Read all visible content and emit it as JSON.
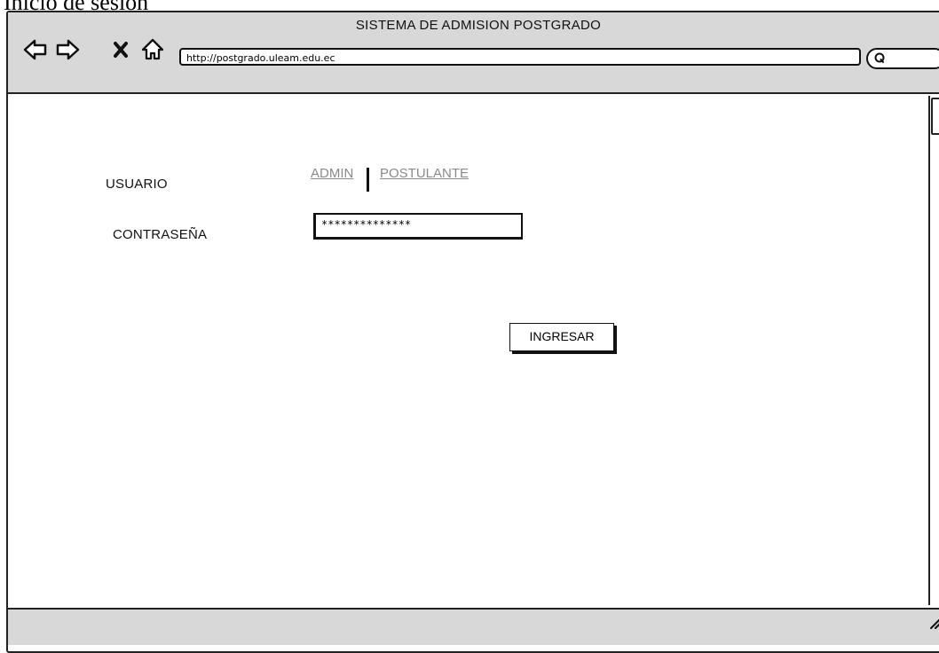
{
  "caption": "Inicio de sesión",
  "window": {
    "title": "SISTEMA DE ADMISION POSTGRADO"
  },
  "browser": {
    "url": "http://postgrado.uleam.edu.ec",
    "icons": [
      "back-arrow-icon",
      "forward-arrow-icon",
      "close-icon",
      "home-icon",
      "search-icon",
      "resize-grip-icon"
    ]
  },
  "form": {
    "usuario_label": "USUARIO",
    "admin_link": "ADMIN",
    "postulante_link": "POSTULANTE",
    "password_label": "CONTRASEÑA",
    "password_value": "**************",
    "submit_label": "INGRESAR"
  },
  "colors": {
    "chrome": "#d8d8d8",
    "border": "#222222",
    "link": "#8a8a8a"
  }
}
